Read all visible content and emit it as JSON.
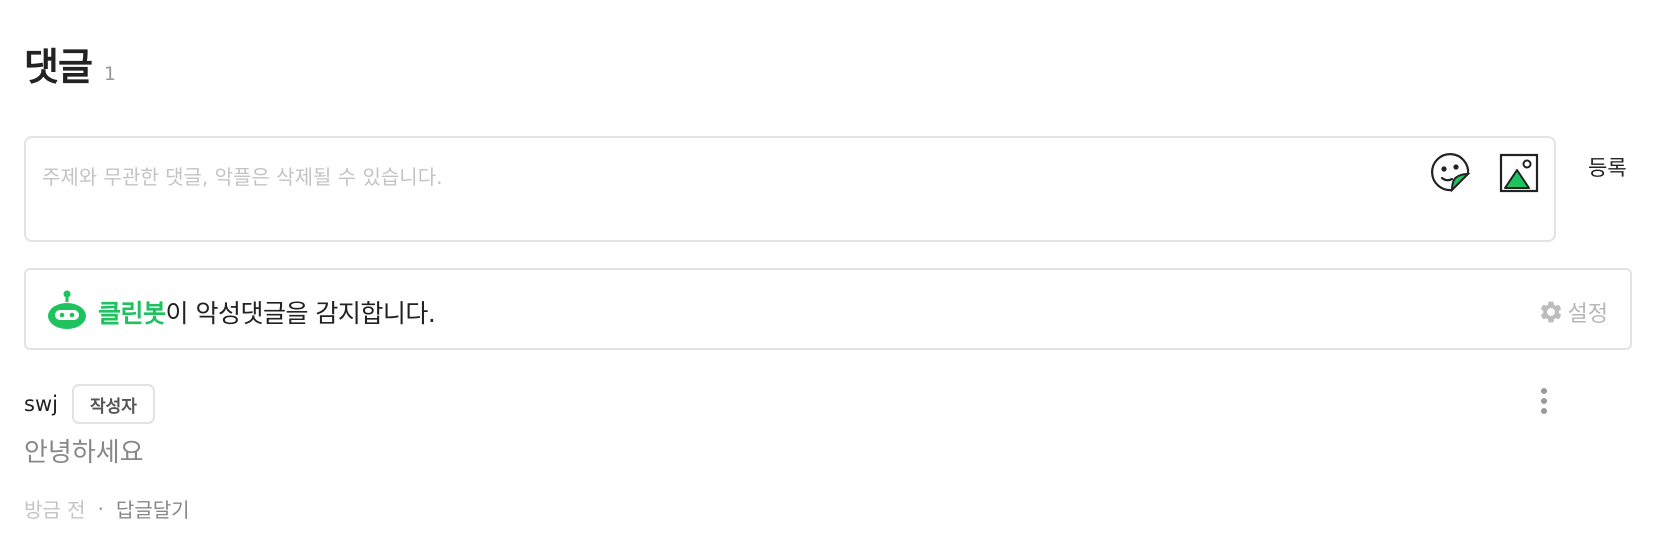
{
  "header": {
    "title": "댓글",
    "count": "1"
  },
  "comment_form": {
    "placeholder": "주제와 무관한 댓글, 악플은 삭제될 수 있습니다.",
    "submit_label": "등록"
  },
  "cleanbot": {
    "name": "클린봇",
    "message": "이 악성댓글을 감지합니다.",
    "settings_label": "설정",
    "accent_color": "#1ec25f"
  },
  "comments": [
    {
      "author": "swj",
      "badge": "작성자",
      "text": "안녕하세요",
      "time": "방금 전",
      "separator": "·",
      "reply_label": "답글달기"
    }
  ]
}
